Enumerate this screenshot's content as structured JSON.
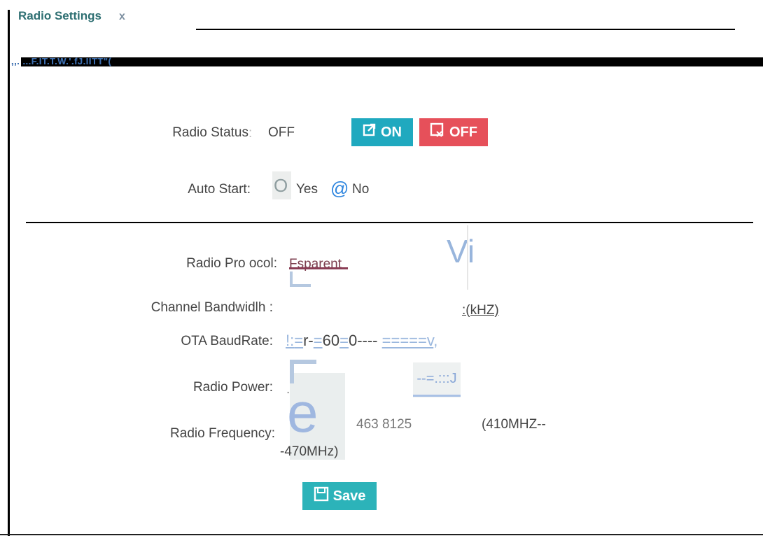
{
  "tab": {
    "title": "Radio Settings",
    "close": "x"
  },
  "band_text": ",,. ...F.IT.T.W.'.fJ.IITT\"(",
  "radio_status": {
    "label": "Radio Status",
    "colon": ":",
    "value": "OFF",
    "on_label": "ON",
    "off_label": "OFF"
  },
  "auto_start": {
    "label": "Auto Start:",
    "option_glyph": "O",
    "yes_label": "Yes",
    "selected_glyph": "@",
    "no_label": "No"
  },
  "radio_protocol": {
    "label": "Radio Pro ocol:",
    "value": "Fsparent",
    "mark": "Vi"
  },
  "channel_bandwidth": {
    "label": "Channel Bandwidlh :",
    "unit": ":(kHZ)"
  },
  "ota_baudrate": {
    "label": "OTA BaudRate:",
    "value_parts": [
      "!:",
      "=",
      "r-",
      "=",
      "60",
      "=",
      "0",
      "----",
      "=====v",
      ","
    ]
  },
  "radio_power": {
    "label": "Radio Power:",
    "dot": ".",
    "select_text": "--=.:::J"
  },
  "radio_frequency": {
    "label": "Radio Frequency:",
    "glyph": "e",
    "value": "463 8125",
    "range_a": "(410MHZ--",
    "range_b": "-470MHz)"
  },
  "save": {
    "label": "Save"
  },
  "colors": {
    "on_button": "#1fa9bf",
    "off_button": "#e6505a",
    "save_button": "#2cb3b9",
    "tab_title": "#2e6f72"
  }
}
